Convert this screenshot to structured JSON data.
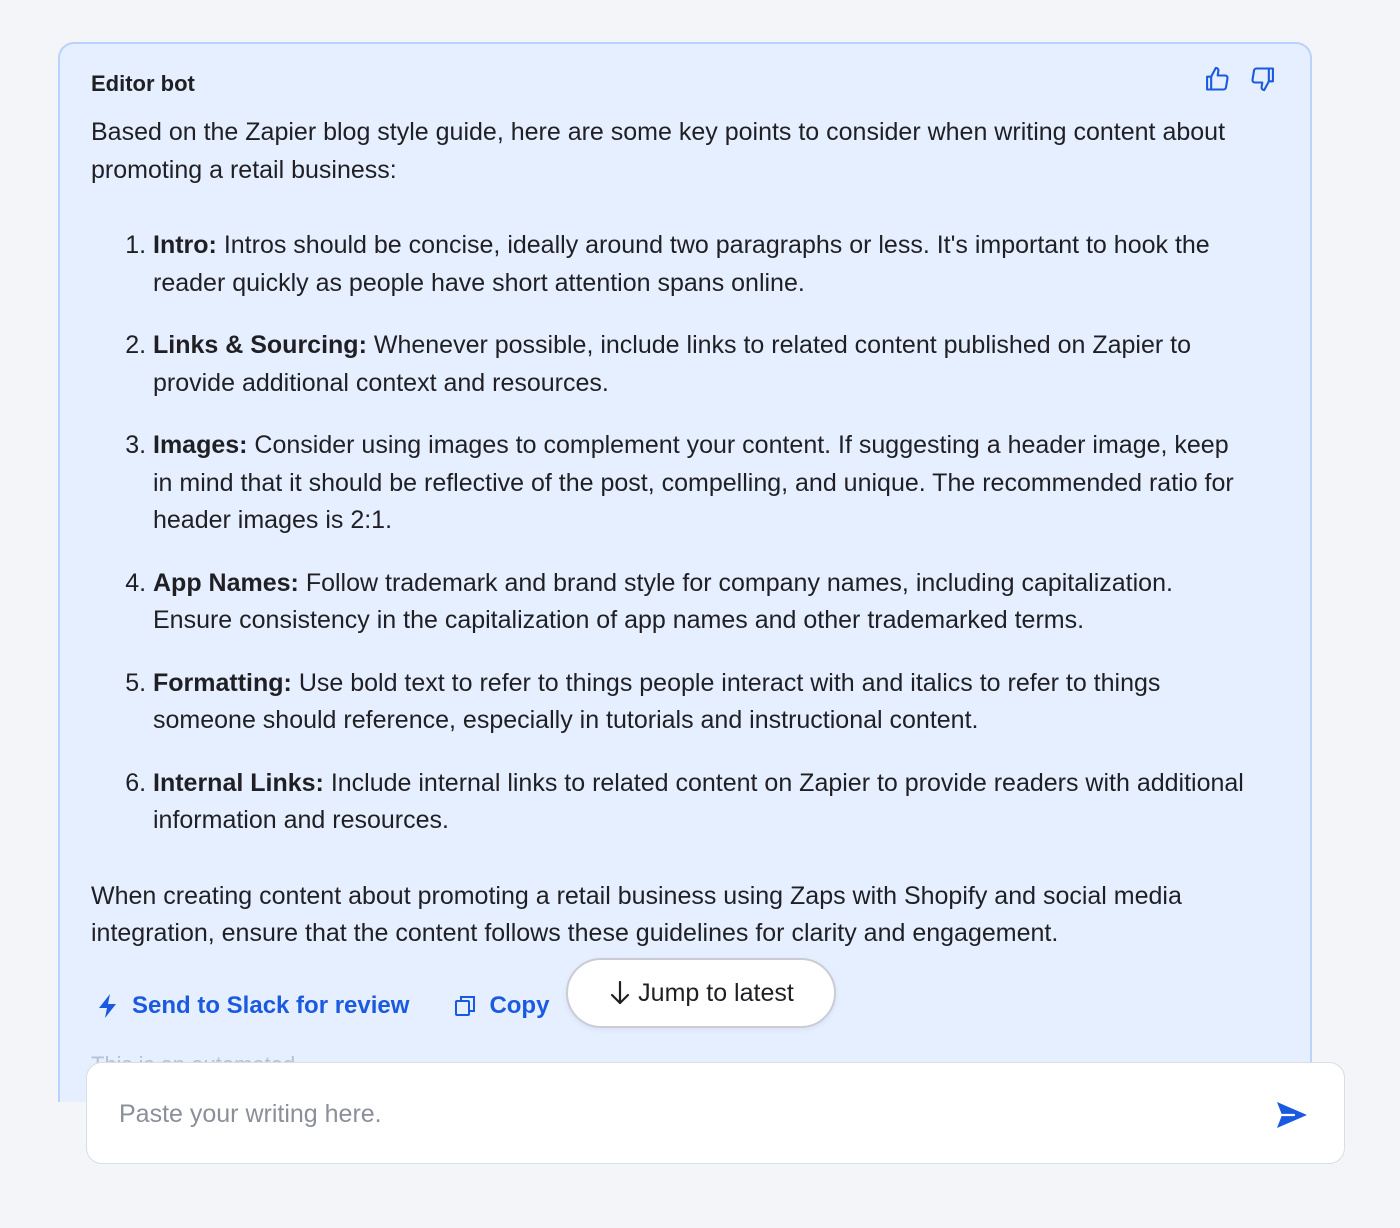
{
  "message": {
    "bot_name": "Editor bot",
    "intro": "Based on the Zapier blog style guide, here are some key points to consider when writing content about promoting a retail business:",
    "points": [
      {
        "title": "Intro:",
        "text": " Intros should be concise, ideally around two paragraphs or less. It's important to hook the reader quickly as people have short attention spans online."
      },
      {
        "title": "Links & Sourcing:",
        "text": " Whenever possible, include links to related content published on Zapier to provide additional context and resources."
      },
      {
        "title": "Images:",
        "text": " Consider using images to complement your content. If suggesting a header image, keep in mind that it should be reflective of the post, compelling, and unique. The recommended ratio for header images is 2:1."
      },
      {
        "title": "App Names:",
        "text": " Follow trademark and brand style for company names, including capitalization. Ensure consistency in the capitalization of app names and other trademarked terms."
      },
      {
        "title": "Formatting:",
        "text": " Use bold text to refer to things people interact with and italics to refer to things someone should reference, especially in tutorials and instructional content."
      },
      {
        "title": "Internal Links:",
        "text": " Include internal links to related content on Zapier to provide readers with additional information and resources."
      }
    ],
    "closing": "When creating content about promoting a retail business using Zaps with Shopify and social media integration, ensure that the content follows these guidelines for clarity and engagement.",
    "partial_line": "This is an automated...",
    "actions": {
      "slack_label": "Send to Slack for review",
      "copy_label": "Copy"
    },
    "feedback": {
      "thumbs_up_icon": "thumbs-up-icon",
      "thumbs_down_icon": "thumbs-down-icon"
    }
  },
  "jump_button": {
    "label": "Jump to latest"
  },
  "composer": {
    "placeholder": "Paste your writing here.",
    "value": ""
  },
  "colors": {
    "accent": "#1a5ae0",
    "card_bg": "#e5efff",
    "card_border": "#b9d3fb",
    "page_bg": "#f3f5f9"
  }
}
